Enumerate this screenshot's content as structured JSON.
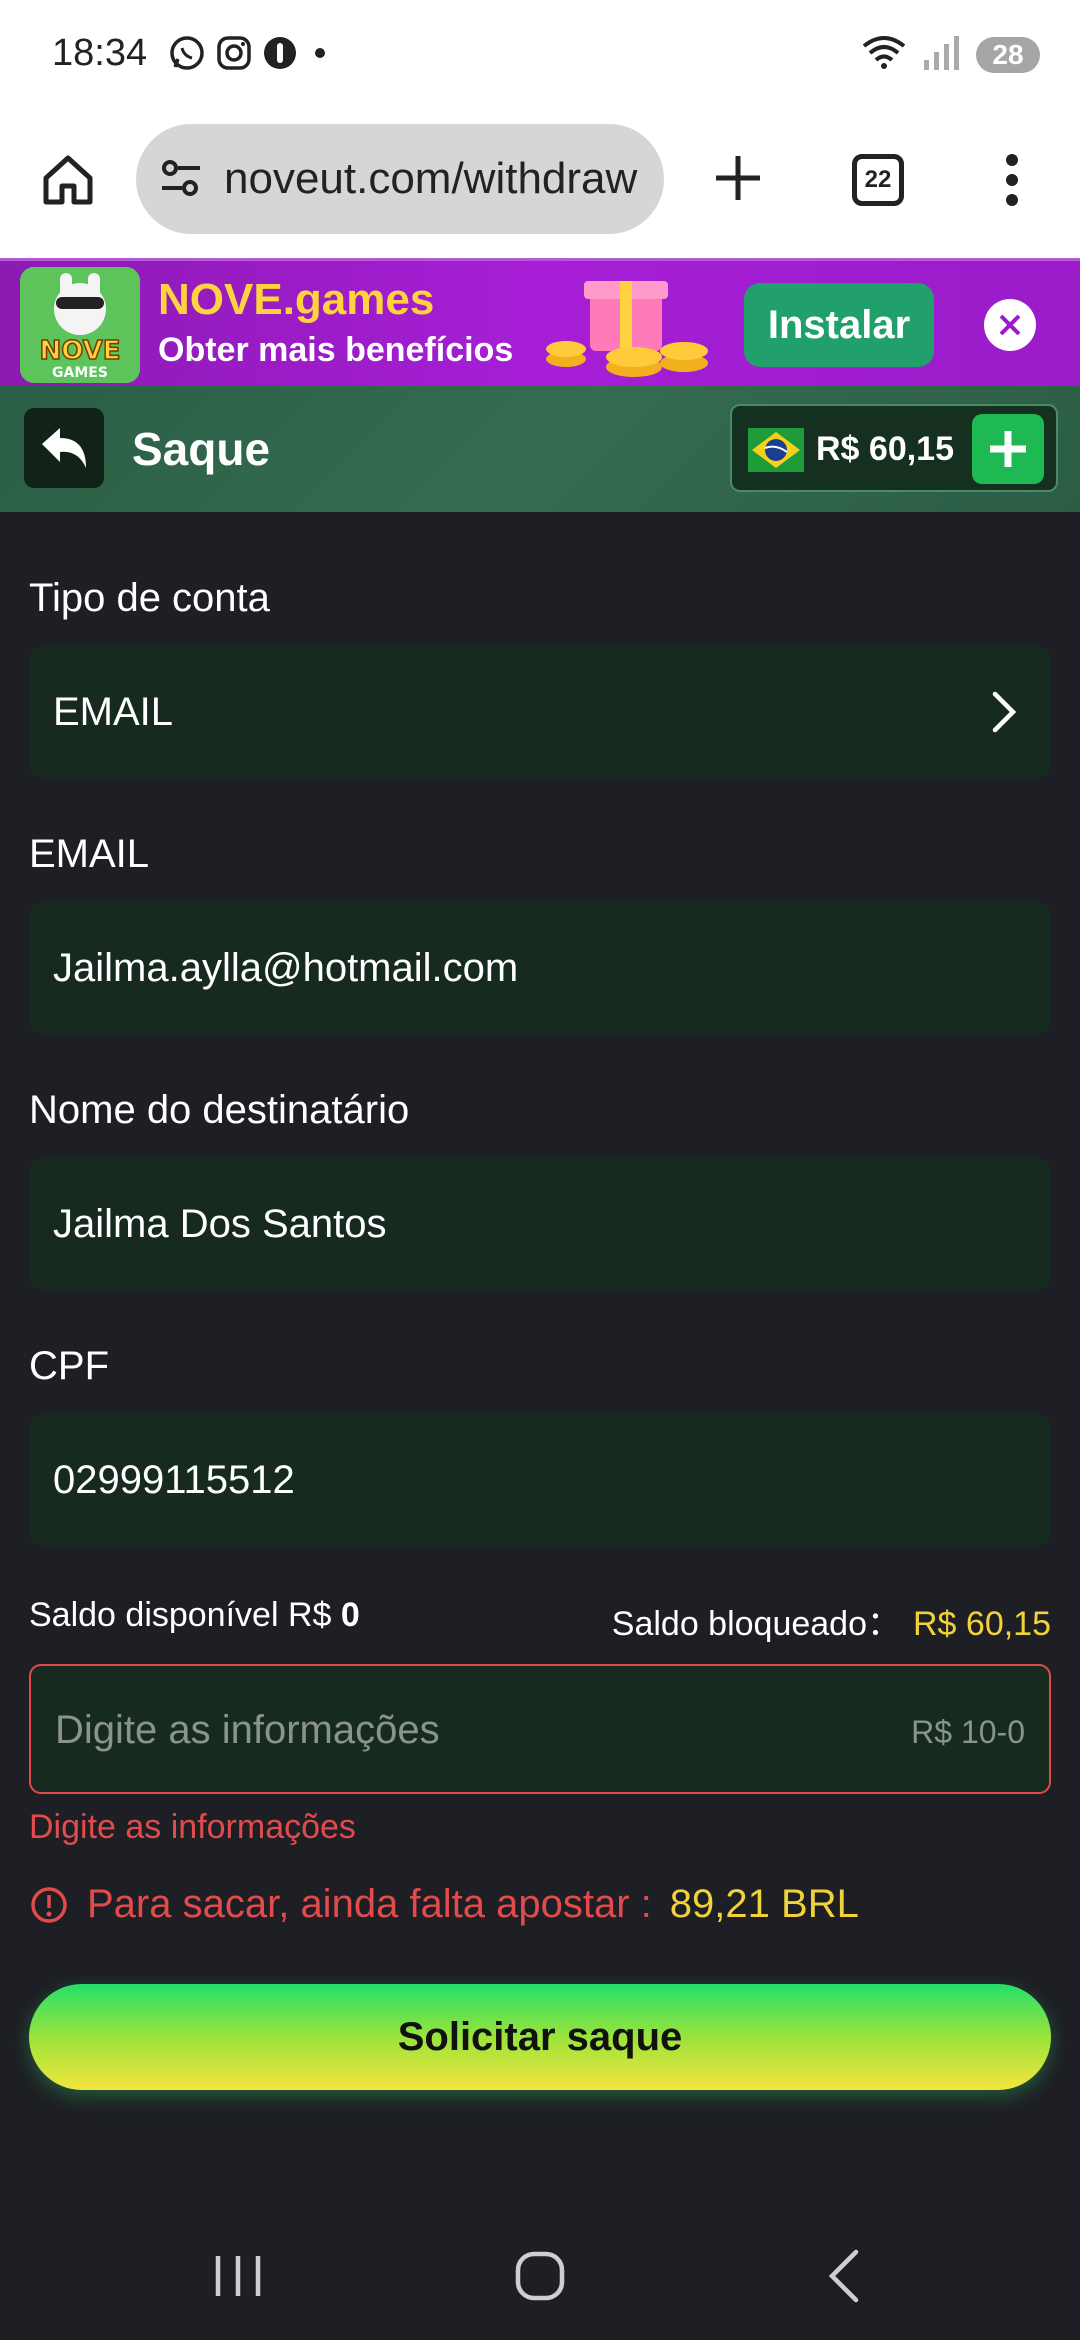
{
  "status_bar": {
    "time": "18:34",
    "battery": "28"
  },
  "browser": {
    "url": "noveut.com/withdraw",
    "tab_count": "22"
  },
  "promo": {
    "title": "NOVE.games",
    "subtitle": "Obter mais benefícios",
    "install_label": "Instalar",
    "logo_text_1": "NOVE",
    "logo_text_2": "GAMES"
  },
  "header": {
    "title": "Saque",
    "balance": "R$ 60,15"
  },
  "form": {
    "account_type_label": "Tipo de conta",
    "account_type_value": "EMAIL",
    "email_label": "EMAIL",
    "email_value": "Jailma.aylla@hotmail.com",
    "recipient_label": "Nome do destinatário",
    "recipient_value": "Jailma Dos Santos",
    "cpf_label": "CPF",
    "cpf_value": "02999115512",
    "available_label": "Saldo disponível R$",
    "available_value": "0",
    "blocked_label": "Saldo bloqueado：",
    "blocked_value": "R$ 60,15",
    "amount_placeholder": "Digite as informações",
    "amount_range": "R$ 10-0",
    "error_text": "Digite as informações",
    "warning_text": "Para sacar, ainda falta apostar :",
    "warning_amount": "89,21 BRL",
    "submit_label": "Solicitar saque"
  },
  "colors": {
    "accent_green": "#22a06b",
    "error_red": "#e24b4b",
    "highlight_yellow": "#f2d23a",
    "field_bg": "#162a20"
  }
}
